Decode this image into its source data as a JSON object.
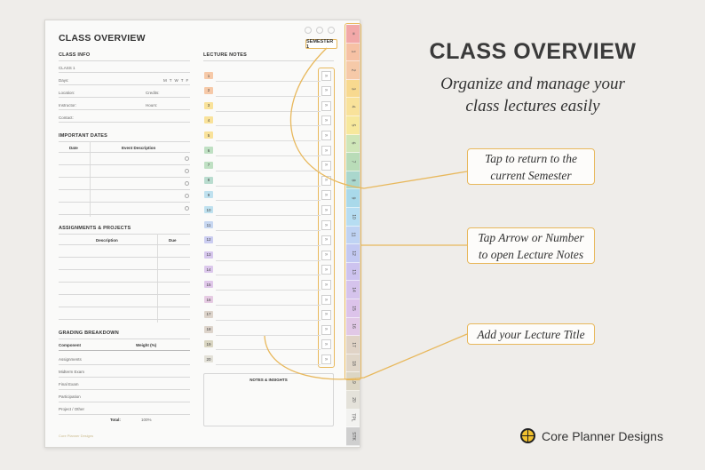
{
  "page": {
    "title": "CLASS OVERVIEW",
    "semester_button": "SEMESTER 1",
    "footer": "Core Planner Designs",
    "class_info": {
      "heading": "CLASS INFO",
      "class_name": "CLASS 1",
      "days_label": "Days:",
      "days": [
        "M",
        "T",
        "W",
        "T",
        "F"
      ],
      "location_label": "Location:",
      "credits_label": "Credits:",
      "instructor_label": "Instructor:",
      "hours_label": "Hours:",
      "contact_label": "Contact:"
    },
    "important_dates": {
      "heading": "IMPORTANT DATES",
      "col_date": "Date",
      "col_event": "Event Description"
    },
    "assignments": {
      "heading": "ASSIGNMENTS & PROJECTS",
      "col_description": "Description",
      "col_due": "Due"
    },
    "grading": {
      "heading": "GRADING BREAKDOWN",
      "col_component": "Component",
      "col_weight": "Weight (%)",
      "rows": [
        "Assignments",
        "Midterm Exam",
        "Final Exam",
        "Participation",
        "Project / Other"
      ],
      "total_label": "Total:",
      "total_value": "100%"
    },
    "lecture_notes": {
      "heading": "LECTURE NOTES",
      "arrow_glyph": "»",
      "lectures": [
        {
          "num": "1",
          "color": "#f6c9a8"
        },
        {
          "num": "2",
          "color": "#f6c9a8"
        },
        {
          "num": "3",
          "color": "#f9e29a"
        },
        {
          "num": "4",
          "color": "#f9e29a"
        },
        {
          "num": "5",
          "color": "#f9e29a"
        },
        {
          "num": "6",
          "color": "#bfe0c3"
        },
        {
          "num": "7",
          "color": "#bfe0c3"
        },
        {
          "num": "8",
          "color": "#b9dccf"
        },
        {
          "num": "9",
          "color": "#bfe1ef"
        },
        {
          "num": "10",
          "color": "#bfe1ef"
        },
        {
          "num": "11",
          "color": "#c7d7f1"
        },
        {
          "num": "12",
          "color": "#cbcdf1"
        },
        {
          "num": "13",
          "color": "#d7c8ee"
        },
        {
          "num": "14",
          "color": "#dcc8ec"
        },
        {
          "num": "15",
          "color": "#e0c8ea"
        },
        {
          "num": "16",
          "color": "#e6cbe3"
        },
        {
          "num": "17",
          "color": "#ddd4cb"
        },
        {
          "num": "18",
          "color": "#ddd4cb"
        },
        {
          "num": "19",
          "color": "#dad6c2"
        },
        {
          "num": "20",
          "color": "#e3e1d8"
        }
      ],
      "notes_heading": "NOTES & INSIGHTS"
    }
  },
  "side_tabs": [
    {
      "label": "≡",
      "color": "#f2a8a8"
    },
    {
      "label": "1",
      "color": "#f6c1a4"
    },
    {
      "label": "2",
      "color": "#f6c9a8"
    },
    {
      "label": "3",
      "color": "#f8d98f"
    },
    {
      "label": "4",
      "color": "#f9e29a"
    },
    {
      "label": "5",
      "color": "#f7e89c"
    },
    {
      "label": "6",
      "color": "#cfe6b8"
    },
    {
      "label": "7",
      "color": "#b9dcb8"
    },
    {
      "label": "8",
      "color": "#aad7cd"
    },
    {
      "label": "9",
      "color": "#a9d9ea"
    },
    {
      "label": "10",
      "color": "#b6ddf2"
    },
    {
      "label": "11",
      "color": "#bfd3f3"
    },
    {
      "label": "12",
      "color": "#c3c9f2"
    },
    {
      "label": "13",
      "color": "#cdc3ef"
    },
    {
      "label": "14",
      "color": "#d5c3ec"
    },
    {
      "label": "15",
      "color": "#dcc3ea"
    },
    {
      "label": "16",
      "color": "#e1c8e6"
    },
    {
      "label": "17",
      "color": "#e0d3c6"
    },
    {
      "label": "18",
      "color": "#e0d6c8"
    },
    {
      "label": "19",
      "color": "#dcd6c4"
    },
    {
      "label": "20",
      "color": "#e4e2da"
    },
    {
      "label": "TPL",
      "color": "#f2f2f0"
    },
    {
      "label": "STK",
      "color": "#cfcfcf"
    }
  ],
  "marketing": {
    "heading": "CLASS OVERVIEW",
    "subheading_line1": "Organize and manage your",
    "subheading_line2": "class lectures easily",
    "callout_semester_line1": "Tap to return to the",
    "callout_semester_line2": "current Semester",
    "callout_arrow_line1": "Tap Arrow or Number",
    "callout_arrow_line2": "to open Lecture Notes",
    "callout_title": "Add your Lecture Title",
    "brand": "Core Planner Designs"
  },
  "colors": {
    "accent": "#e8b85c",
    "background": "#efedea"
  }
}
